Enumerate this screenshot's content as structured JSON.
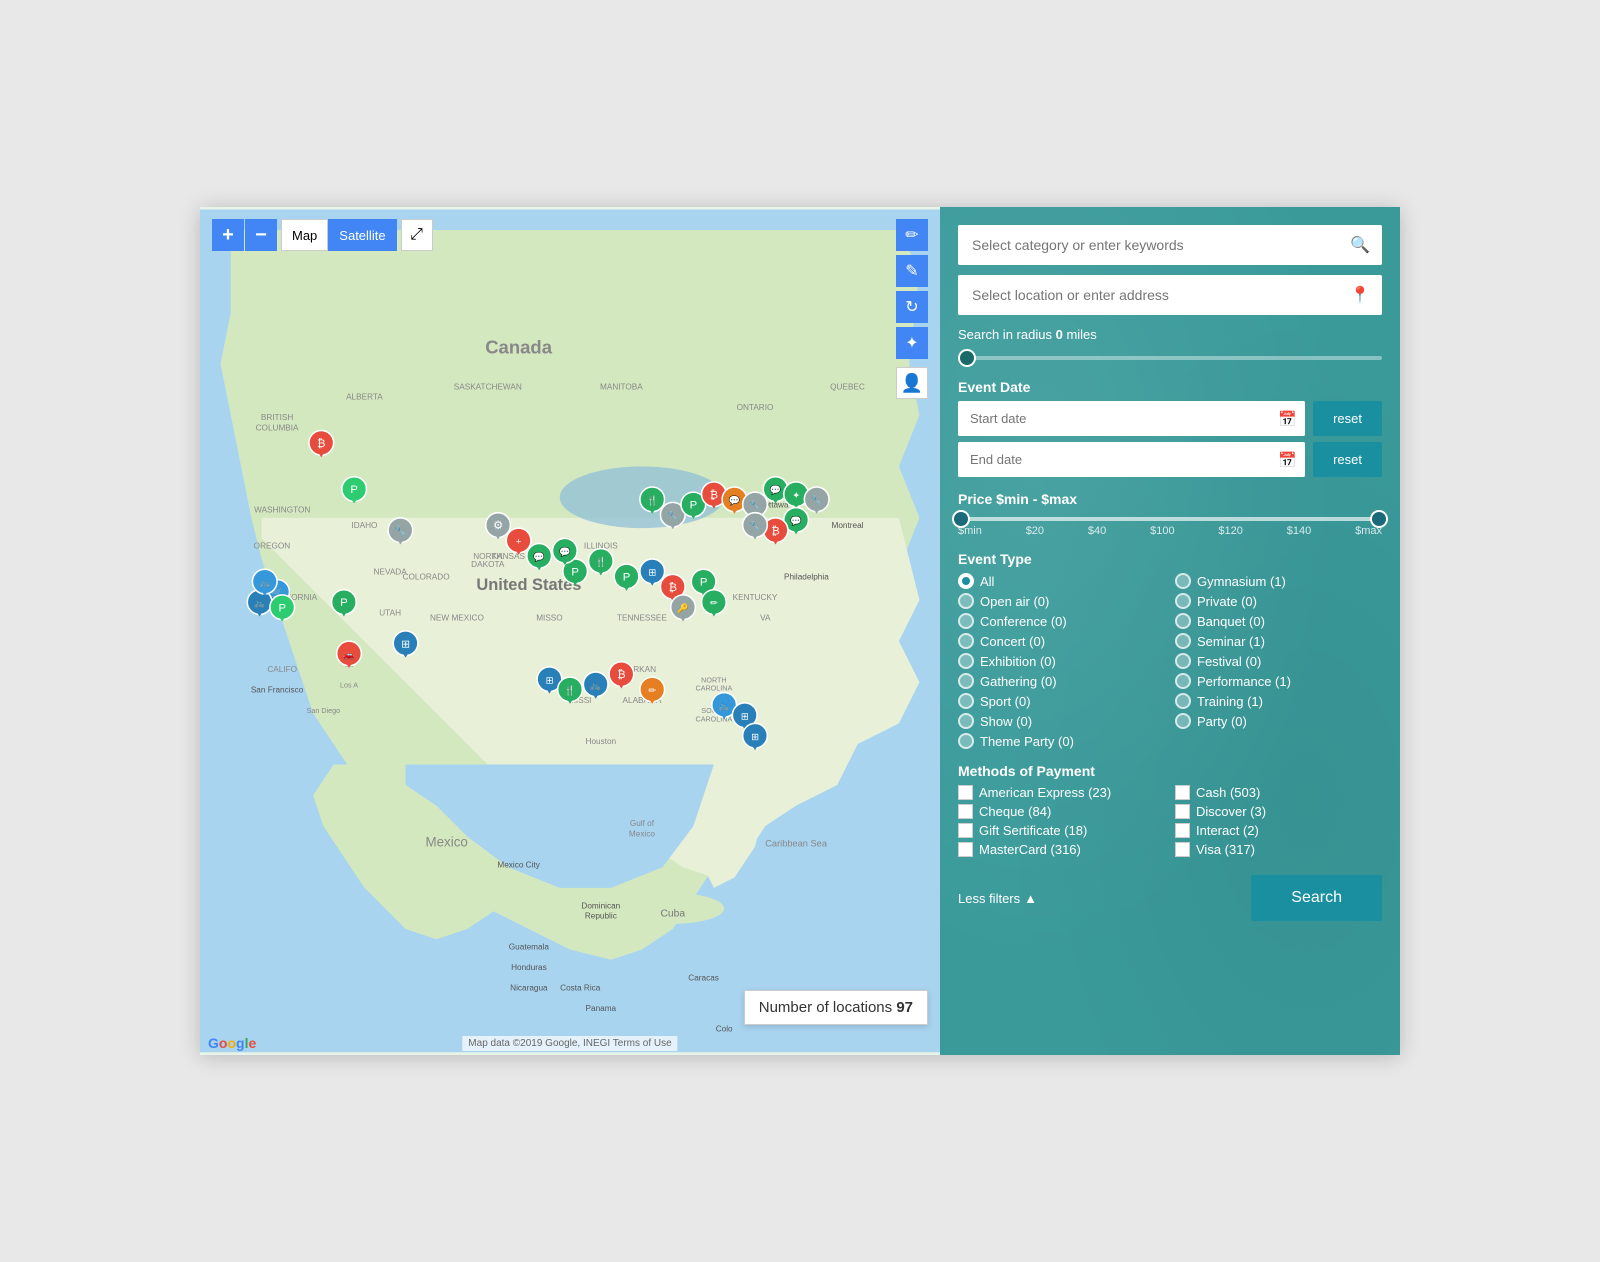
{
  "map": {
    "controls": {
      "zoom_in": "+",
      "zoom_out": "−",
      "map_label": "Map",
      "satellite_label": "Satellite"
    },
    "location_count_label": "Number of locations",
    "location_count": "97",
    "attribution": "Map data ©2019 Google, INEGI  Terms of Use",
    "google_logo": "Google",
    "carolina_text": "CAROLINA"
  },
  "sidebar": {
    "category_placeholder": "Select category or enter keywords",
    "location_placeholder": "Select location or enter address",
    "radius_label": "Search in radius",
    "radius_value": "0",
    "radius_unit": "miles",
    "event_date_label": "Event Date",
    "start_date_placeholder": "Start date",
    "end_date_placeholder": "End date",
    "reset_label": "reset",
    "price_label": "Price $min - $max",
    "price_ticks": [
      "$min",
      "$20",
      "$40",
      "$100",
      "$120",
      "$140",
      "$max"
    ],
    "event_type_label": "Event Type",
    "event_types_left": [
      {
        "label": "All",
        "count": "",
        "selected": true
      },
      {
        "label": "Open air",
        "count": "(0)",
        "selected": false
      },
      {
        "label": "Conference",
        "count": "(0)",
        "selected": false
      },
      {
        "label": "Concert",
        "count": "(0)",
        "selected": false
      },
      {
        "label": "Exhibition",
        "count": "(0)",
        "selected": false
      },
      {
        "label": "Gathering",
        "count": "(0)",
        "selected": false
      },
      {
        "label": "Sport",
        "count": "(0)",
        "selected": false
      },
      {
        "label": "Show",
        "count": "(0)",
        "selected": false
      },
      {
        "label": "Theme Party",
        "count": "(0)",
        "selected": false
      }
    ],
    "event_types_right": [
      {
        "label": "Gymnasium",
        "count": "(1)",
        "selected": false
      },
      {
        "label": "Private",
        "count": "(0)",
        "selected": false
      },
      {
        "label": "Banquet",
        "count": "(0)",
        "selected": false
      },
      {
        "label": "Seminar",
        "count": "(1)",
        "selected": false
      },
      {
        "label": "Festival",
        "count": "(0)",
        "selected": false
      },
      {
        "label": "Performance",
        "count": "(1)",
        "selected": false
      },
      {
        "label": "Training",
        "count": "(1)",
        "selected": false
      },
      {
        "label": "Party",
        "count": "(0)",
        "selected": false
      }
    ],
    "payment_label": "Methods of Payment",
    "payments_left": [
      {
        "label": "American Express (23)"
      },
      {
        "label": "Cheque (84)"
      },
      {
        "label": "Gift Sertificate (18)"
      },
      {
        "label": "MasterCard (316)"
      }
    ],
    "payments_right": [
      {
        "label": "Cash (503)"
      },
      {
        "label": "Discover (3)"
      },
      {
        "label": "Interact (2)"
      },
      {
        "label": "Visa (317)"
      }
    ],
    "less_filters_label": "Less filters",
    "search_label": "Search"
  }
}
